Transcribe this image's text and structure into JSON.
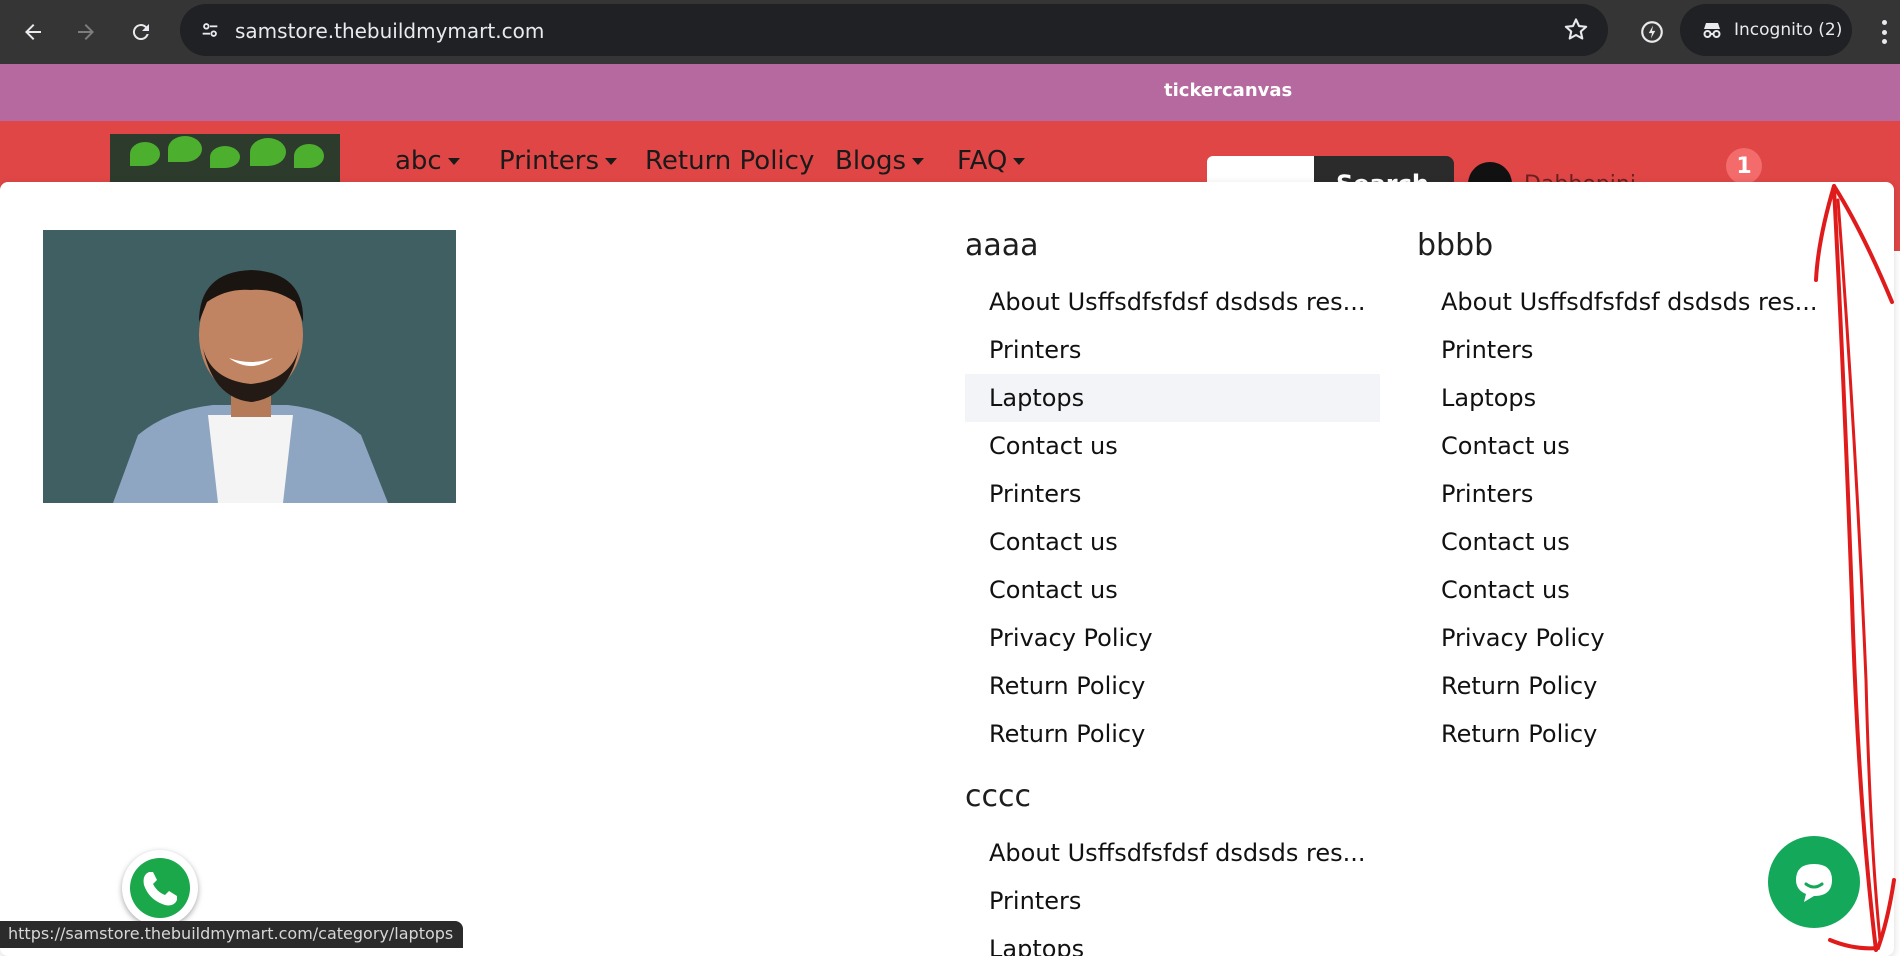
{
  "browser": {
    "url": "samstore.thebuildmymart.com",
    "incognito_label": "Incognito (2)",
    "status_url": "https://samstore.thebuildmymart.com/category/laptops"
  },
  "site": {
    "ticker_text": "tickercanvas",
    "nav": [
      {
        "label": "abc",
        "dropdown": true
      },
      {
        "label": "Printers",
        "dropdown": true
      },
      {
        "label": "Return Policy",
        "dropdown": false
      },
      {
        "label": "Blogs",
        "dropdown": true
      },
      {
        "label": "FAQ",
        "dropdown": true
      }
    ],
    "search_button_label": "Search",
    "account_name": "Dabbopini",
    "cart_count": "1"
  },
  "mega_menu": {
    "columns": [
      {
        "title": "aaaa",
        "items": [
          "About Usffsdfsfdsf dsdsds res...",
          "Printers",
          "Laptops",
          "Contact us",
          "Printers",
          "Contact us",
          "Contact us",
          "Privacy Policy",
          "Return Policy",
          "Return Policy"
        ],
        "highlighted_index": 2
      },
      {
        "title": "bbbb",
        "items": [
          "About Usffsdfsfdsf dsdsds res...",
          "Printers",
          "Laptops",
          "Contact us",
          "Printers",
          "Contact us",
          "Contact us",
          "Privacy Policy",
          "Return Policy",
          "Return Policy"
        ]
      },
      {
        "title": "cccc",
        "items": [
          "About Usffsdfsfdsf dsdsds res...",
          "Printers",
          "Laptops"
        ]
      }
    ]
  },
  "colors": {
    "ticker": "#b5699e",
    "header": "#e04646",
    "chat": "#14a85b",
    "annotation": "#e01b1b"
  }
}
